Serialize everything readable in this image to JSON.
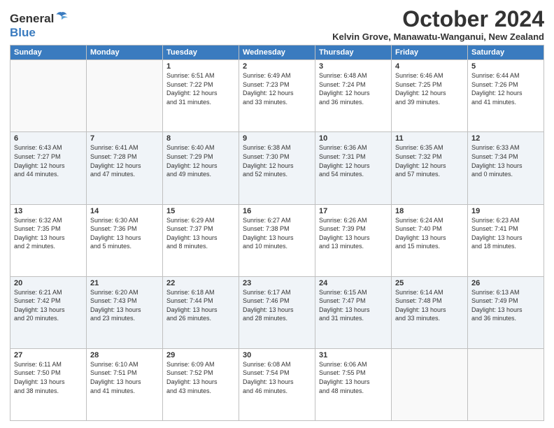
{
  "header": {
    "logo_general": "General",
    "logo_blue": "Blue",
    "main_title": "October 2024",
    "subtitle": "Kelvin Grove, Manawatu-Wanganui, New Zealand"
  },
  "calendar": {
    "days_of_week": [
      "Sunday",
      "Monday",
      "Tuesday",
      "Wednesday",
      "Thursday",
      "Friday",
      "Saturday"
    ],
    "weeks": [
      {
        "row_class": "row-odd",
        "days": [
          {
            "num": "",
            "info": "",
            "empty": true
          },
          {
            "num": "",
            "info": "",
            "empty": true
          },
          {
            "num": "1",
            "info": "Sunrise: 6:51 AM\nSunset: 7:22 PM\nDaylight: 12 hours\nand 31 minutes.",
            "empty": false
          },
          {
            "num": "2",
            "info": "Sunrise: 6:49 AM\nSunset: 7:23 PM\nDaylight: 12 hours\nand 33 minutes.",
            "empty": false
          },
          {
            "num": "3",
            "info": "Sunrise: 6:48 AM\nSunset: 7:24 PM\nDaylight: 12 hours\nand 36 minutes.",
            "empty": false
          },
          {
            "num": "4",
            "info": "Sunrise: 6:46 AM\nSunset: 7:25 PM\nDaylight: 12 hours\nand 39 minutes.",
            "empty": false
          },
          {
            "num": "5",
            "info": "Sunrise: 6:44 AM\nSunset: 7:26 PM\nDaylight: 12 hours\nand 41 minutes.",
            "empty": false
          }
        ]
      },
      {
        "row_class": "row-even",
        "days": [
          {
            "num": "6",
            "info": "Sunrise: 6:43 AM\nSunset: 7:27 PM\nDaylight: 12 hours\nand 44 minutes.",
            "empty": false
          },
          {
            "num": "7",
            "info": "Sunrise: 6:41 AM\nSunset: 7:28 PM\nDaylight: 12 hours\nand 47 minutes.",
            "empty": false
          },
          {
            "num": "8",
            "info": "Sunrise: 6:40 AM\nSunset: 7:29 PM\nDaylight: 12 hours\nand 49 minutes.",
            "empty": false
          },
          {
            "num": "9",
            "info": "Sunrise: 6:38 AM\nSunset: 7:30 PM\nDaylight: 12 hours\nand 52 minutes.",
            "empty": false
          },
          {
            "num": "10",
            "info": "Sunrise: 6:36 AM\nSunset: 7:31 PM\nDaylight: 12 hours\nand 54 minutes.",
            "empty": false
          },
          {
            "num": "11",
            "info": "Sunrise: 6:35 AM\nSunset: 7:32 PM\nDaylight: 12 hours\nand 57 minutes.",
            "empty": false
          },
          {
            "num": "12",
            "info": "Sunrise: 6:33 AM\nSunset: 7:34 PM\nDaylight: 13 hours\nand 0 minutes.",
            "empty": false
          }
        ]
      },
      {
        "row_class": "row-odd",
        "days": [
          {
            "num": "13",
            "info": "Sunrise: 6:32 AM\nSunset: 7:35 PM\nDaylight: 13 hours\nand 2 minutes.",
            "empty": false
          },
          {
            "num": "14",
            "info": "Sunrise: 6:30 AM\nSunset: 7:36 PM\nDaylight: 13 hours\nand 5 minutes.",
            "empty": false
          },
          {
            "num": "15",
            "info": "Sunrise: 6:29 AM\nSunset: 7:37 PM\nDaylight: 13 hours\nand 8 minutes.",
            "empty": false
          },
          {
            "num": "16",
            "info": "Sunrise: 6:27 AM\nSunset: 7:38 PM\nDaylight: 13 hours\nand 10 minutes.",
            "empty": false
          },
          {
            "num": "17",
            "info": "Sunrise: 6:26 AM\nSunset: 7:39 PM\nDaylight: 13 hours\nand 13 minutes.",
            "empty": false
          },
          {
            "num": "18",
            "info": "Sunrise: 6:24 AM\nSunset: 7:40 PM\nDaylight: 13 hours\nand 15 minutes.",
            "empty": false
          },
          {
            "num": "19",
            "info": "Sunrise: 6:23 AM\nSunset: 7:41 PM\nDaylight: 13 hours\nand 18 minutes.",
            "empty": false
          }
        ]
      },
      {
        "row_class": "row-even",
        "days": [
          {
            "num": "20",
            "info": "Sunrise: 6:21 AM\nSunset: 7:42 PM\nDaylight: 13 hours\nand 20 minutes.",
            "empty": false
          },
          {
            "num": "21",
            "info": "Sunrise: 6:20 AM\nSunset: 7:43 PM\nDaylight: 13 hours\nand 23 minutes.",
            "empty": false
          },
          {
            "num": "22",
            "info": "Sunrise: 6:18 AM\nSunset: 7:44 PM\nDaylight: 13 hours\nand 26 minutes.",
            "empty": false
          },
          {
            "num": "23",
            "info": "Sunrise: 6:17 AM\nSunset: 7:46 PM\nDaylight: 13 hours\nand 28 minutes.",
            "empty": false
          },
          {
            "num": "24",
            "info": "Sunrise: 6:15 AM\nSunset: 7:47 PM\nDaylight: 13 hours\nand 31 minutes.",
            "empty": false
          },
          {
            "num": "25",
            "info": "Sunrise: 6:14 AM\nSunset: 7:48 PM\nDaylight: 13 hours\nand 33 minutes.",
            "empty": false
          },
          {
            "num": "26",
            "info": "Sunrise: 6:13 AM\nSunset: 7:49 PM\nDaylight: 13 hours\nand 36 minutes.",
            "empty": false
          }
        ]
      },
      {
        "row_class": "row-odd",
        "days": [
          {
            "num": "27",
            "info": "Sunrise: 6:11 AM\nSunset: 7:50 PM\nDaylight: 13 hours\nand 38 minutes.",
            "empty": false
          },
          {
            "num": "28",
            "info": "Sunrise: 6:10 AM\nSunset: 7:51 PM\nDaylight: 13 hours\nand 41 minutes.",
            "empty": false
          },
          {
            "num": "29",
            "info": "Sunrise: 6:09 AM\nSunset: 7:52 PM\nDaylight: 13 hours\nand 43 minutes.",
            "empty": false
          },
          {
            "num": "30",
            "info": "Sunrise: 6:08 AM\nSunset: 7:54 PM\nDaylight: 13 hours\nand 46 minutes.",
            "empty": false
          },
          {
            "num": "31",
            "info": "Sunrise: 6:06 AM\nSunset: 7:55 PM\nDaylight: 13 hours\nand 48 minutes.",
            "empty": false
          },
          {
            "num": "",
            "info": "",
            "empty": true
          },
          {
            "num": "",
            "info": "",
            "empty": true
          }
        ]
      }
    ]
  }
}
